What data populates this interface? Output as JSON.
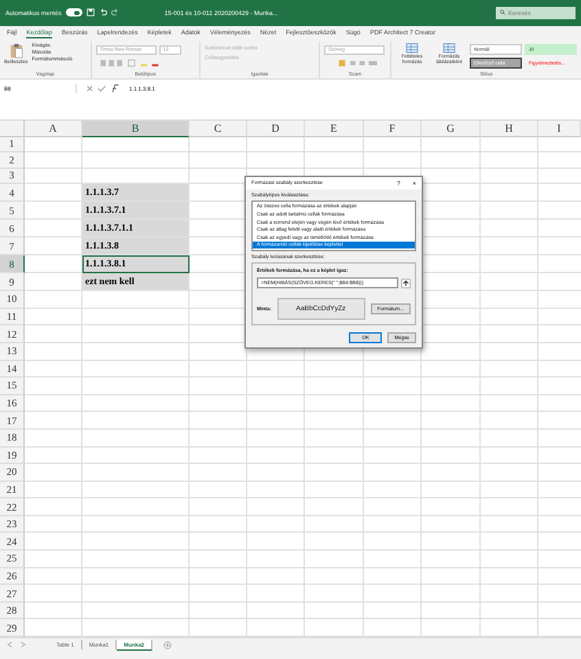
{
  "title_bar": {
    "autosave_label": "Automatikus mentés",
    "autosave_on": true,
    "title": "15-001 és 10-011 2020200429 - Munka...",
    "search_placeholder": "Keresés"
  },
  "ribbon_tabs": [
    {
      "label": "Fájl",
      "selected": false
    },
    {
      "label": "Kezdőlap",
      "selected": true
    },
    {
      "label": "Beszúrás",
      "selected": false
    },
    {
      "label": "Lapelrendezés",
      "selected": false
    },
    {
      "label": "Képletek",
      "selected": false
    },
    {
      "label": "Adatok",
      "selected": false
    },
    {
      "label": "Véleményezés",
      "selected": false
    },
    {
      "label": "Nézet",
      "selected": false
    },
    {
      "label": "Fejlesztőeszközök",
      "selected": false
    },
    {
      "label": "Súgó",
      "selected": false
    },
    {
      "label": "PDF Architect 7 Creator",
      "selected": false
    }
  ],
  "ribbon": {
    "clipboard": {
      "paste": "Beillesztés",
      "items": [
        "Kivágás",
        "Másolás",
        "Formátummásoló"
      ],
      "label": "Vágólap"
    },
    "font": {
      "name": "Times New Roman",
      "size": "12",
      "label": "Betűtípus"
    },
    "alignment": {
      "items": [
        "Sortöréssel több sorba",
        "Cellaegyesítés"
      ],
      "label": "Igazítás"
    },
    "number": {
      "format": "Szöveg",
      "label": "Szám"
    },
    "styles": {
      "buttons": [
        "Feltételes formázás",
        "Formázás táblázatként"
      ],
      "label": "Stílus",
      "cells": [
        {
          "label": "Normál",
          "kind": "normal"
        },
        {
          "label": "Jó",
          "kind": "good"
        },
        {
          "label": "Ellenőrző cella",
          "kind": "check"
        },
        {
          "label": "Figyelmeztetés...",
          "kind": "warning"
        }
      ]
    }
  },
  "formula_bar": {
    "name_box": "B8",
    "formula": "1.1.1.3.8.1"
  },
  "columns": [
    {
      "label": "A",
      "selected": false
    },
    {
      "label": "B",
      "selected": true
    },
    {
      "label": "C",
      "selected": false
    },
    {
      "label": "D",
      "selected": false
    },
    {
      "label": "E",
      "selected": false
    },
    {
      "label": "F",
      "selected": false
    },
    {
      "label": "G",
      "selected": false
    },
    {
      "label": "H",
      "selected": false
    },
    {
      "label": "I",
      "selected": false
    }
  ],
  "rows": [
    {
      "number": "1",
      "selected": false
    },
    {
      "number": "2",
      "selected": false
    },
    {
      "number": "3",
      "selected": false
    },
    {
      "number": "4",
      "selected": false,
      "b": "1.1.1.3.7",
      "shaded": true
    },
    {
      "number": "5",
      "selected": false,
      "b": "1.1.1.3.7.1",
      "shaded": true
    },
    {
      "number": "6",
      "selected": false,
      "b": "1.1.1.3.7.1.1",
      "shaded": true
    },
    {
      "number": "7",
      "selected": false,
      "b": "1.1.1.3.8",
      "shaded": true
    },
    {
      "number": "8",
      "selected": true,
      "b": "1.1.1.3.8.1",
      "shaded": true
    },
    {
      "number": "9",
      "selected": false,
      "b": "ezt nem kell",
      "shaded": true
    },
    {
      "number": "10",
      "selected": false
    },
    {
      "number": "11",
      "selected": false
    },
    {
      "number": "12",
      "selected": false
    },
    {
      "number": "13",
      "selected": false
    },
    {
      "number": "14",
      "selected": false
    },
    {
      "number": "15",
      "selected": false
    },
    {
      "number": "16",
      "selected": false
    },
    {
      "number": "17",
      "selected": false
    },
    {
      "number": "18",
      "selected": false
    },
    {
      "number": "19",
      "selected": false
    },
    {
      "number": "20",
      "selected": false
    },
    {
      "number": "21",
      "selected": false
    },
    {
      "number": "22",
      "selected": false
    },
    {
      "number": "23",
      "selected": false
    },
    {
      "number": "24",
      "selected": false
    },
    {
      "number": "25",
      "selected": false
    },
    {
      "number": "26",
      "selected": false
    },
    {
      "number": "27",
      "selected": false
    },
    {
      "number": "28",
      "selected": false
    },
    {
      "number": "29",
      "selected": false
    }
  ],
  "dialog": {
    "title": "Formázási szabály szerkesztése",
    "help": "?",
    "close": "×",
    "type_label": "Szabálytípus kiválasztása:",
    "rule_types": [
      {
        "label": "Az összes cella formázása az értékek alapján",
        "selected": false
      },
      {
        "label": "Csak az adott tartalmú cellák formázása",
        "selected": false
      },
      {
        "label": "Csak a sorrend elején vagy végén lévő értékek formázása",
        "selected": false
      },
      {
        "label": "Csak az átlag feletti vagy alatti értékek formázása",
        "selected": false
      },
      {
        "label": "Csak az egyedi vagy az ismétlődő értékek formázása",
        "selected": false
      },
      {
        "label": "A formázandó cellák kijelölése képlettel",
        "selected": true
      }
    ],
    "edit_label": "Szabály leírásának szerkesztése:",
    "formula_label": "Értékek formázása, ha ez a képlet igaz:",
    "formula": "=NEM(HIBÁS(SZÖVEG.KERES(\" \";$B4:$B8)))",
    "preview_label": "Minta:",
    "preview": "AaBbCcDdYyZz",
    "format_button": "Formátum...",
    "ok": "OK",
    "cancel": "Mégse"
  },
  "sheet_tabs": [
    {
      "label": "Table 1",
      "selected": false
    },
    {
      "label": "Munka1",
      "selected": false
    },
    {
      "label": "Munka2",
      "selected": true
    }
  ]
}
